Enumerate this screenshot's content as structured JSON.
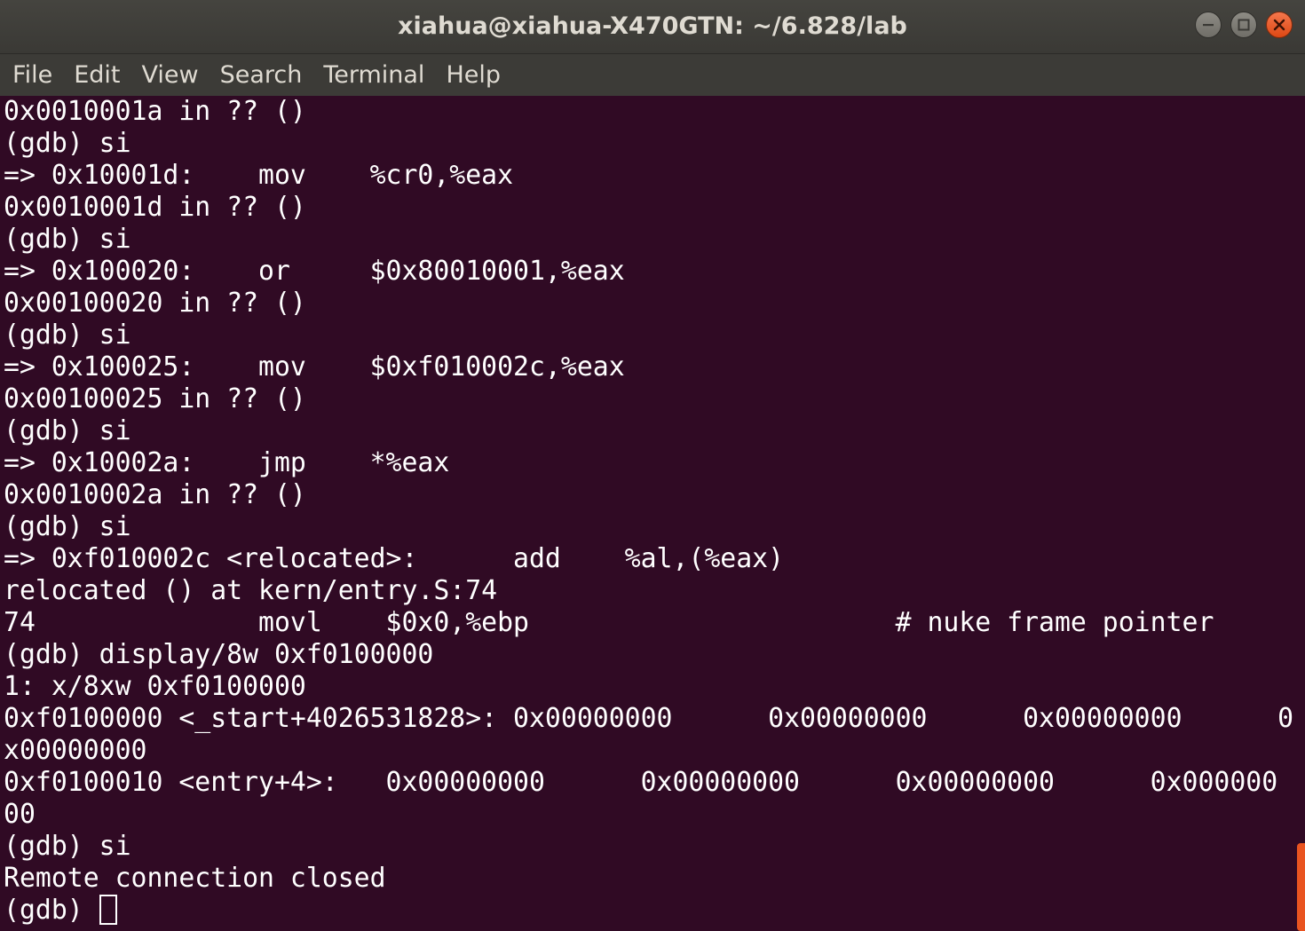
{
  "window": {
    "title": "xiahua@xiahua-X470GTN: ~/6.828/lab"
  },
  "colors": {
    "terminal_bg": "#300a24",
    "terminal_fg": "#ffffff",
    "titlebar_bg": "#3c3b37",
    "close_button": "#e95420",
    "scrollbar_thumb": "#e95420"
  },
  "menu": {
    "items": [
      "File",
      "Edit",
      "View",
      "Search",
      "Terminal",
      "Help"
    ]
  },
  "terminal": {
    "lines": [
      "0x0010001a in ?? ()",
      "(gdb) si",
      "=> 0x10001d:    mov    %cr0,%eax",
      "0x0010001d in ?? ()",
      "(gdb) si",
      "=> 0x100020:    or     $0x80010001,%eax",
      "0x00100020 in ?? ()",
      "(gdb) si",
      "=> 0x100025:    mov    $0xf010002c,%eax",
      "0x00100025 in ?? ()",
      "(gdb) si",
      "=> 0x10002a:    jmp    *%eax",
      "0x0010002a in ?? ()",
      "(gdb) si",
      "=> 0xf010002c <relocated>:      add    %al,(%eax)",
      "relocated () at kern/entry.S:74",
      "74              movl    $0x0,%ebp                       # nuke frame pointer",
      "(gdb) display/8w 0xf0100000",
      "1: x/8xw 0xf0100000",
      "0xf0100000 <_start+4026531828>: 0x00000000      0x00000000      0x00000000      0",
      "x00000000",
      "0xf0100010 <entry+4>:   0x00000000      0x00000000      0x00000000      0x000000",
      "00",
      "(gdb) si",
      "Remote connection closed"
    ],
    "prompt": "(gdb) "
  }
}
